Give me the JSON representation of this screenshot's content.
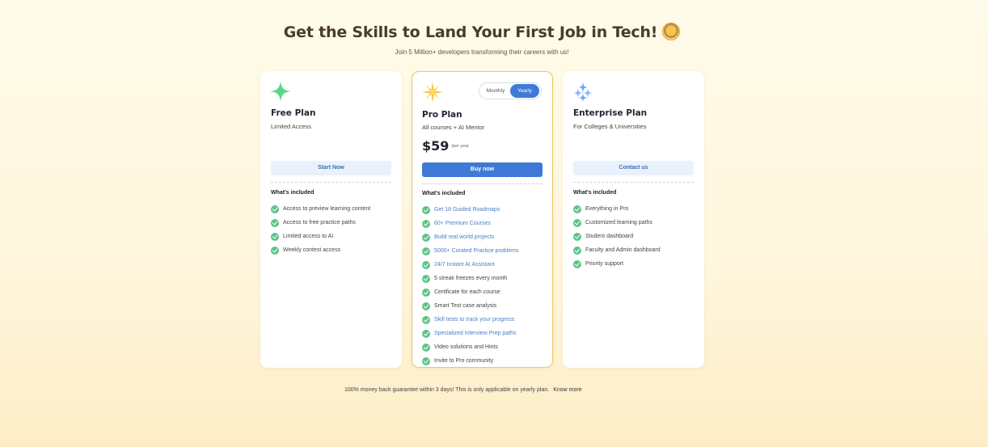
{
  "hero": {
    "title": "Get the Skills to Land Your First Job in Tech!",
    "subtitle": "Join 5 Million+ developers transforming their careers with us!",
    "badge_icon": "medal-icon"
  },
  "billing_toggle": {
    "options": [
      "Monthly",
      "Yearly"
    ],
    "selected": "Yearly"
  },
  "plans": [
    {
      "name": "Free Plan",
      "description": "Limited Access",
      "icon": "green-sparkle-icon",
      "cta": "Start Now",
      "included_title": "What's included",
      "features": [
        "Access to preview learning content",
        "Access to free practice paths",
        "Limited access to AI",
        "Weekly contest access"
      ]
    },
    {
      "name": "Pro Plan",
      "description": "All courses + AI Mentor",
      "icon": "gold-sparkle-icon",
      "price": "$59",
      "period": "/per year",
      "cta": "Buy now",
      "included_title": "What's included",
      "features": [
        "Get 18 Guided Roadmaps",
        "60+ Premium Courses",
        "Build real world projects",
        "5000+ Curated Practice problems",
        "24/7 Instant AI Assistant",
        "5 streak freezes every month",
        "Certificate for each course",
        "Smart Test case analysis",
        "Skill tests to track your progress",
        "Specialized Interview Prep paths",
        "Video solutions and Hints",
        "Invite to Pro community"
      ]
    },
    {
      "name": "Enterprise Plan",
      "description": "For Colleges & Universities",
      "icon": "blue-sparkles-icon",
      "cta": "Contact us",
      "included_title": "What's included",
      "features": [
        "Everything in Pro",
        "Customized learning paths",
        "Student dashboard",
        "Faculty and Admin dashboard",
        "Priority support"
      ]
    }
  ],
  "footer": {
    "text": "100% money back guarantee within 3 days! This is only applicable on yearly plan.",
    "link": "Know more"
  },
  "colors": {
    "accent": "#3f79d8",
    "check": "#5cc486",
    "pro_border": "#efc567",
    "highlight_text": "#4a7fc6"
  }
}
